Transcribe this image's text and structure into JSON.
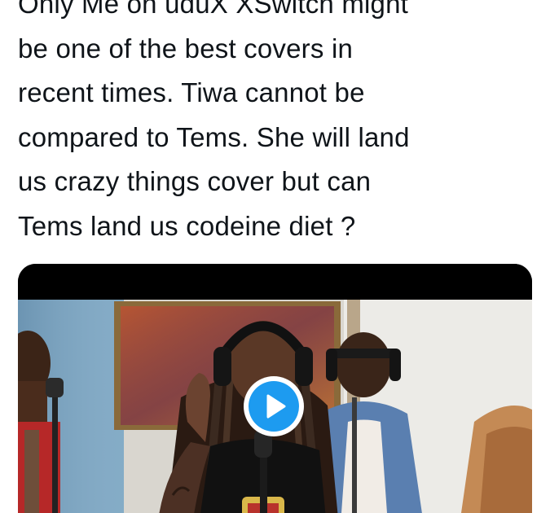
{
  "tweet": {
    "lines": [
      "Only Me on uduX XSwitch might",
      "be one of the best covers in",
      "recent times. Tiwa cannot be",
      "compared to Tems. She will land",
      "us crazy things cover but can",
      "Tems land us codeine diet ?"
    ]
  },
  "media": {
    "type": "video",
    "icons": {
      "play": "play-icon"
    },
    "colors": {
      "play_button": "#1d9bf0",
      "play_ring": "#ffffff"
    }
  }
}
